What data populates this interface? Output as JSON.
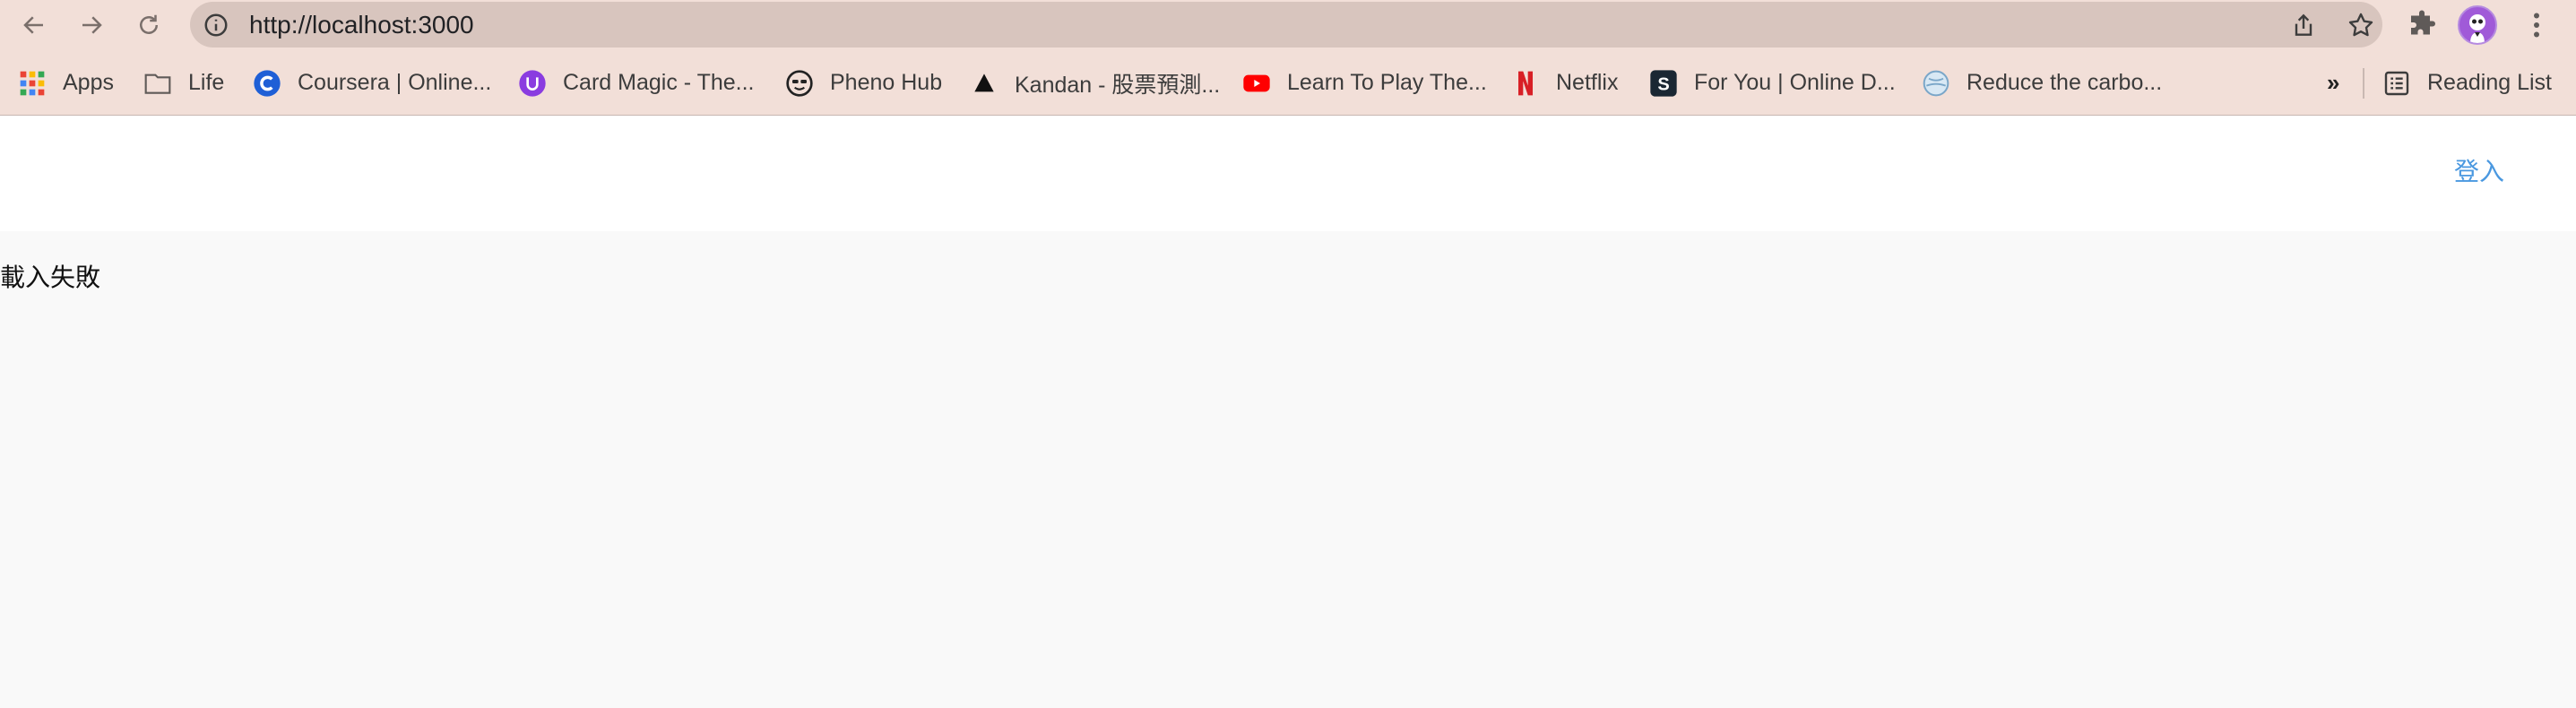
{
  "browser": {
    "url": "http://localhost:3000",
    "bookmarks": [
      {
        "label": "Apps",
        "icon": "apps-grid-icon"
      },
      {
        "label": "Life",
        "icon": "folder-icon"
      },
      {
        "label": "Coursera | Online...",
        "icon": "coursera-icon"
      },
      {
        "label": "Card Magic - The...",
        "icon": "card-magic-icon"
      },
      {
        "label": "Pheno Hub",
        "icon": "pheno-hub-icon"
      },
      {
        "label": "Kandan - 股票預測...",
        "icon": "kandan-icon"
      },
      {
        "label": "Learn To Play The...",
        "icon": "youtube-icon"
      },
      {
        "label": "Netflix",
        "icon": "netflix-icon"
      },
      {
        "label": "For You | Online D...",
        "icon": "scribd-icon"
      },
      {
        "label": "Reduce the carbo...",
        "icon": "globe-icon"
      }
    ],
    "overflow_label": "»",
    "reading_list_label": "Reading List"
  },
  "page": {
    "login_label": "登入",
    "error_message": "載入失敗"
  },
  "colors": {
    "toolbar_bg": "#f2dfd8",
    "omnibox_bg": "#d8c5be",
    "link": "#4a98e0",
    "page_bg": "#f9f9f9",
    "avatar": "#a05ad8"
  }
}
